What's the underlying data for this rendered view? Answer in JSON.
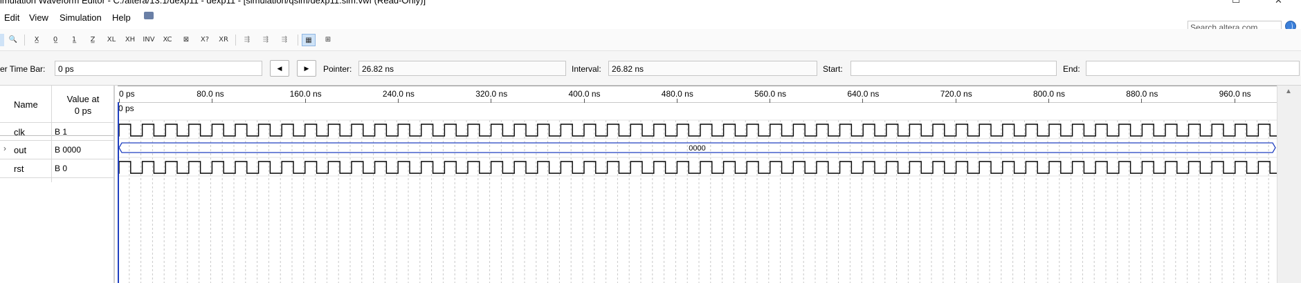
{
  "window": {
    "title": "imulation Waveform Editor - C:/altera/13.1/dexp11 - dexp11 - [simulation/qsim/dexp11.sim.vwf (Read-Only)]"
  },
  "menu": {
    "items": [
      "Edit",
      "View",
      "Simulation",
      "Help"
    ]
  },
  "search": {
    "placeholder": "Search altera.com"
  },
  "toolbar": {
    "buttons": [
      "zoom-tool",
      "zoom-in",
      "forcing-unknown",
      "forcing-low",
      "forcing-high",
      "high-impedance",
      "weak-low",
      "weak-high",
      "invert",
      "count-value",
      "clock",
      "arbitrary-value",
      "random-value",
      "snap-to-grid",
      "insert-node",
      "group",
      "ungroup",
      "display-grid",
      "waveform-settings"
    ]
  },
  "timebar": {
    "master_label": "er Time Bar:",
    "master_value": "0 ps",
    "pointer_label": "Pointer:",
    "pointer_value": "26.82 ns",
    "interval_label": "Interval:",
    "interval_value": "26.82 ns",
    "start_label": "Start:",
    "start_value": "",
    "end_label": "End:",
    "end_value": ""
  },
  "grid": {
    "name_header": "Name",
    "value_header": "Value at\n0 ps",
    "time_zero": "0 ps"
  },
  "ruler": {
    "ticks": [
      "0 ps",
      "80.0 ns",
      "160.0 ns",
      "240.0 ns",
      "320.0 ns",
      "400.0 ns",
      "480.0 ns",
      "560.0 ns",
      "640.0 ns",
      "720.0 ns",
      "800.0 ns",
      "880.0 ns",
      "960.0 ns"
    ]
  },
  "signals": [
    {
      "name": "clk",
      "value": "B 1",
      "type": "clock",
      "expandable": false
    },
    {
      "name": "out",
      "value": "B 0000",
      "type": "bus",
      "bus_value": "0000",
      "expandable": true
    },
    {
      "name": "rst",
      "value": "B 0",
      "type": "clock",
      "expandable": false
    }
  ],
  "colors": {
    "cursor": "#1f3fbf",
    "bus": "#1f3fbf",
    "wave": "#000000",
    "grid_dash": "#c8c8c8"
  }
}
